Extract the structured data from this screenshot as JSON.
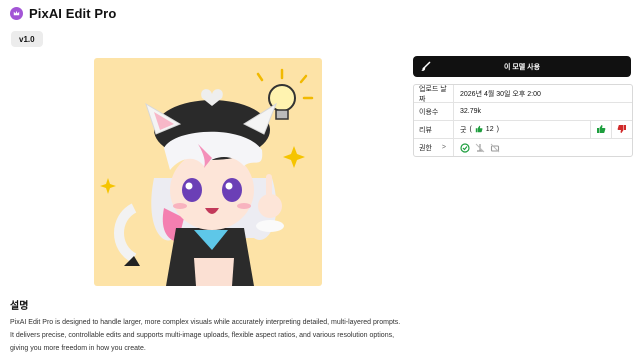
{
  "app": {
    "title": "PixAI Edit Pro",
    "version": "v1.0"
  },
  "action": {
    "label": "이 모델 사용"
  },
  "info": {
    "upload_label": "업로드 날짜",
    "upload_value": "2026년 4월 30일 오후 2:00",
    "usage_label": "이용수",
    "usage_value": "32.79k",
    "review_label": "리뷰",
    "review_value": "굿",
    "review_paren_open": "(",
    "review_count": "12",
    "review_paren_close": ")",
    "perm_label": "권한",
    "perm_chevron": ">"
  },
  "section": {
    "heading": "설명",
    "description": "PixAI Edit Pro is designed to handle larger, more complex visuals while accurately interpreting detailed, multi-layered prompts. It delivers precise, controllable edits and supports multi-image uploads, flexible aspect ratios, and various resolution options, giving you more freedom in how you create."
  },
  "colors": {
    "accent": "#a355d6",
    "preview_bg": "#fde3a7",
    "thumb_up": "#1e9e3e",
    "thumb_down": "#d12b2b",
    "button": "#111111"
  },
  "icons": [
    "pixai-logo-icon",
    "brush-icon",
    "thumbs-up-icon",
    "thumbs-down-icon",
    "chevron-right-icon",
    "permission-icon",
    "permission-no-commercial-icon",
    "permission-no-share-icon"
  ]
}
